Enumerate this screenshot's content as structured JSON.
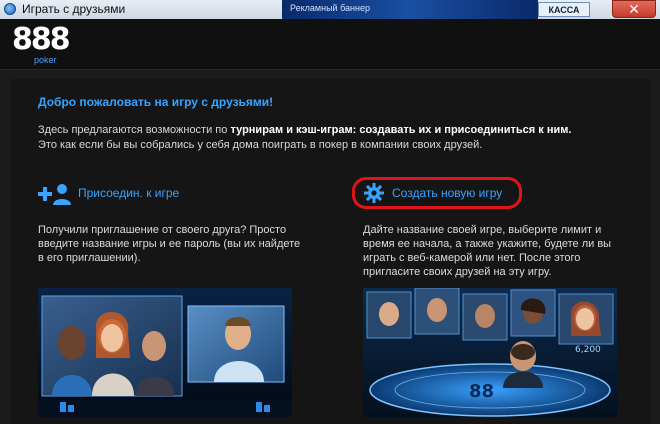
{
  "window": {
    "title": "Играть с друзьями",
    "banner_text": "Рекламный баннер",
    "banner_button": "КАССА",
    "close_label": "✕"
  },
  "logo": {
    "number": "888",
    "sub": "poker"
  },
  "welcome": "Добро пожаловать на игру с друзьями!",
  "intro": {
    "line1_prefix": "Здесь предлагаются возможности по ",
    "line1_bold": "турнирам и кэш-играм: создавать их и присоединиться к ним.",
    "line2": "Это как если бы вы собрались у себя дома поиграть в покер в компании своих друзей."
  },
  "join": {
    "label": "Присоедин. к игре",
    "text": "Получили приглашение от своего друга? Просто введите название игры и ее пароль (вы их найдете в его приглашении)."
  },
  "create": {
    "label": "Создать новую игру",
    "text": "Дайте название своей игре, выберите лимит и время ее начала, а также укажите, будете ли вы играть с веб-камерой или нет. После этого пригласите своих друзей на эту игру."
  },
  "scene_right": {
    "table_text": "88",
    "amount": "6,200"
  },
  "colors": {
    "accent": "#37a4ff",
    "highlight": "#e0141a"
  },
  "icons": {
    "join": "add-user-icon",
    "create": "gear-icon"
  }
}
